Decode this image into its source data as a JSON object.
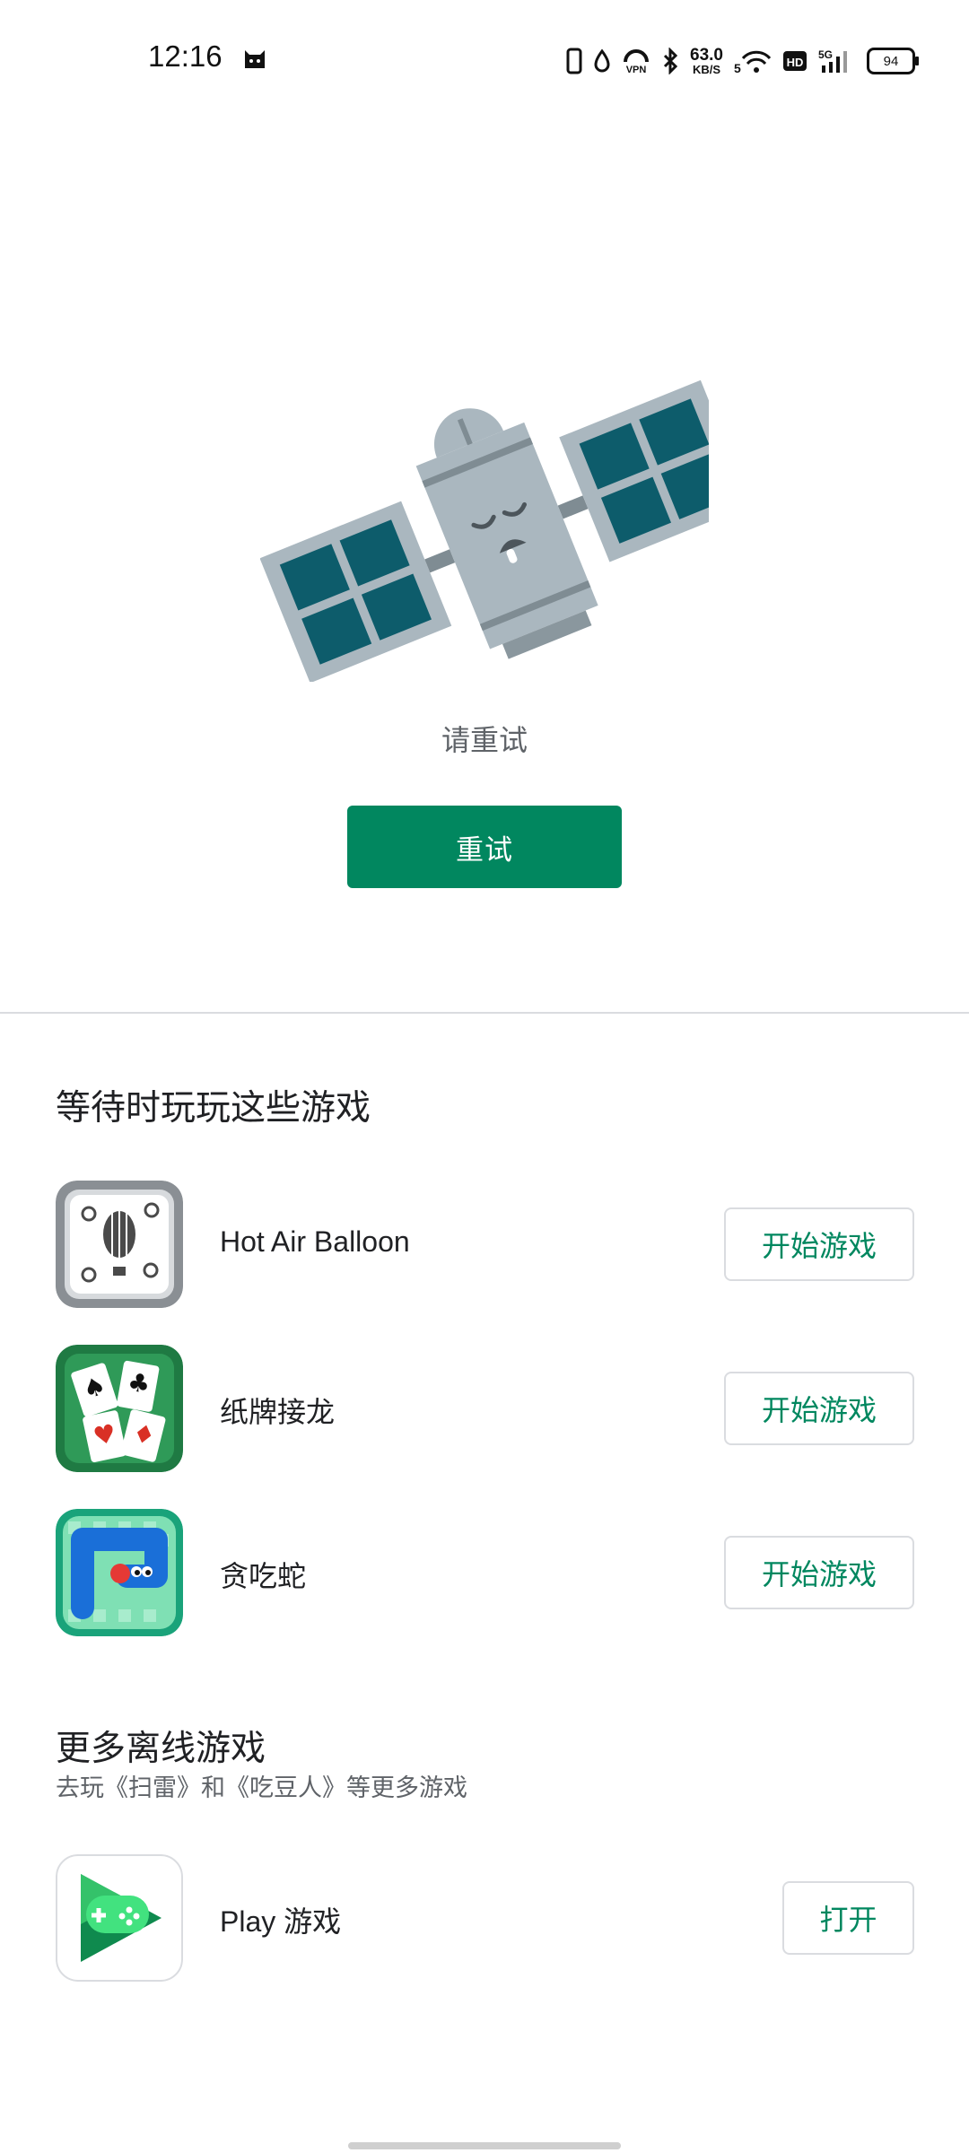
{
  "status_bar": {
    "time": "12:16",
    "speed_value": "63.0",
    "speed_unit": "KB/S",
    "battery": "94",
    "icons": [
      "cat-icon",
      "vibrate-icon",
      "drop-icon",
      "vpn-icon",
      "bluetooth-icon",
      "wifi-icon",
      "hd-icon",
      "signal-5g-icon",
      "battery-icon"
    ]
  },
  "error": {
    "message": "请重试",
    "retry_label": "重试"
  },
  "games_section": {
    "title": "等待时玩玩这些游戏",
    "games": [
      {
        "name": "Hot Air Balloon",
        "button": "开始游戏",
        "icon": "hot-air-balloon-icon"
      },
      {
        "name": "纸牌接龙",
        "button": "开始游戏",
        "icon": "solitaire-icon"
      },
      {
        "name": "贪吃蛇",
        "button": "开始游戏",
        "icon": "snake-icon"
      }
    ]
  },
  "more_section": {
    "title": "更多离线游戏",
    "subtitle": "去玩《扫雷》和《吃豆人》等更多游戏",
    "app": {
      "name": "Play 游戏",
      "button": "打开",
      "icon": "play-games-icon"
    }
  },
  "colors": {
    "accent": "#01875f",
    "divider": "#dadce0",
    "satellite_panel": "#0d5c6b",
    "satellite_body": "#aab7bf"
  }
}
